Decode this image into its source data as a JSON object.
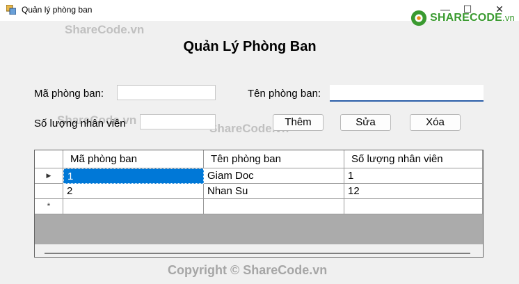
{
  "window": {
    "title": "Quản lý phòng ban",
    "minimize_glyph": "—",
    "maximize_glyph": "☐",
    "close_glyph": "✕"
  },
  "logo": {
    "main": "SHARECODE",
    "sub": ".vn"
  },
  "watermarks": [
    "ShareCode.vn",
    "ShareCode.vn",
    "ShareCode.vn"
  ],
  "copyright": "Copyright © ShareCode.vn",
  "heading": "Quản Lý Phòng Ban",
  "form": {
    "ma_label": "Mã phòng ban:",
    "ma_value": "",
    "ten_label": "Tên phòng ban:",
    "ten_value": "",
    "soluong_label": "Số lượng nhân viên",
    "soluong_value": ""
  },
  "buttons": {
    "them": "Thêm",
    "sua": "Sửa",
    "xoa": "Xóa"
  },
  "grid": {
    "columns": [
      "Mã phòng ban",
      "Tên phòng ban",
      "Số lượng nhân viên"
    ],
    "rows": [
      {
        "indicator": "▶",
        "cells": [
          "1",
          "Giam Doc",
          "1"
        ]
      },
      {
        "indicator": "",
        "cells": [
          "2",
          "Nhan Su",
          "12"
        ]
      }
    ],
    "new_row_indicator": "*"
  },
  "colors": {
    "accent": "#0078d7",
    "logo_green": "#3a9a30"
  }
}
